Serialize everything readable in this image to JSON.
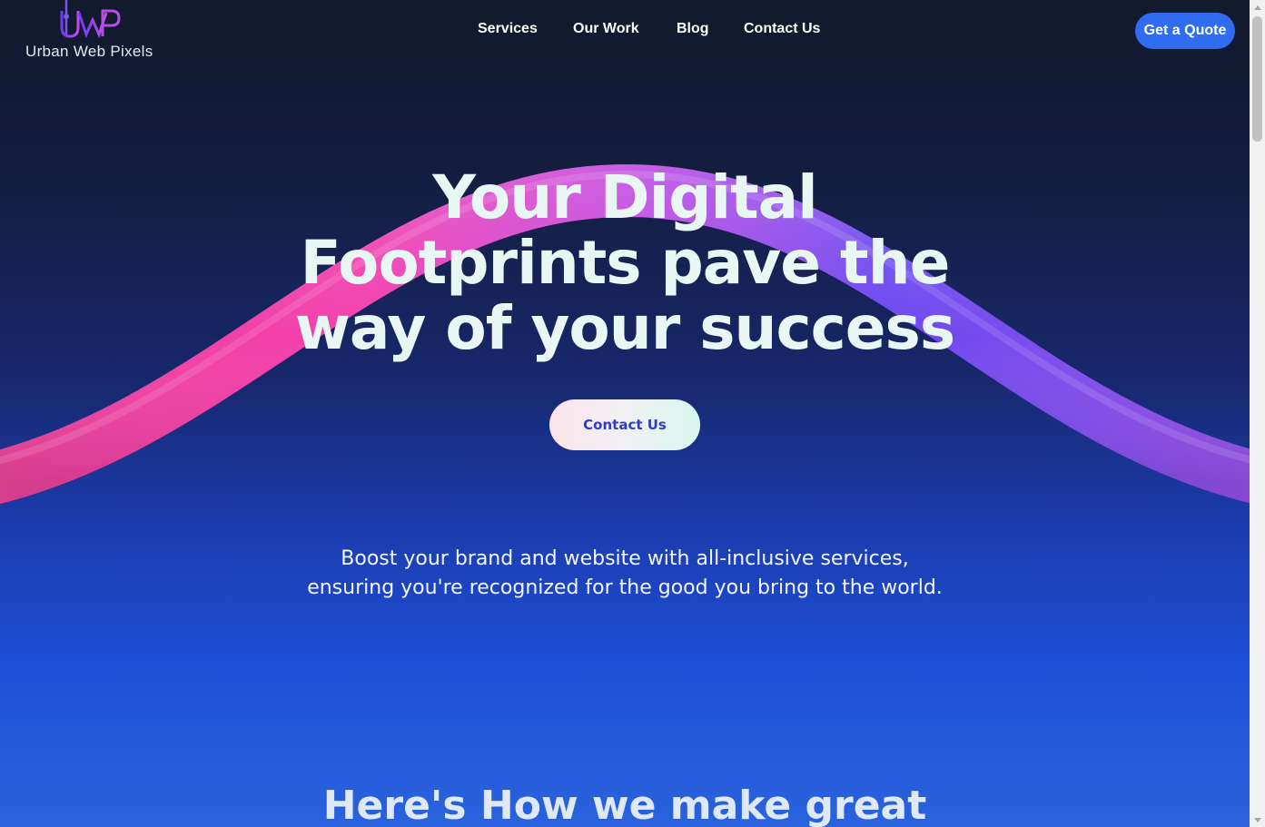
{
  "brand": {
    "name": "Urban Web Pixels",
    "logo_icon": "uwp-tower-logo"
  },
  "nav": {
    "items": [
      {
        "label": "Services"
      },
      {
        "label": "Our Work"
      },
      {
        "label": "Blog"
      },
      {
        "label": "Contact Us"
      }
    ],
    "quote_button": "Get a Quote"
  },
  "hero": {
    "title_lines": [
      "Your Digital",
      "Footprints pave the",
      "way of your success"
    ],
    "cta_label": "Contact Us",
    "subtitle_lines": [
      "Boost your brand and website with all-inclusive services,",
      "ensuring you're recognized for the good you bring to the world."
    ]
  },
  "next_section": {
    "heading": "Here's How we make great"
  },
  "colors": {
    "accent": "#2f6cf0",
    "wave_start": "#ff3fa8",
    "wave_end": "#7b4dff",
    "cta_text": "#2d3ec2"
  }
}
